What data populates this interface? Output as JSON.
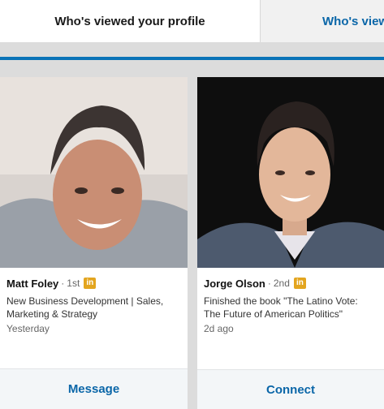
{
  "tabs": [
    {
      "label": "Who's viewed your profile",
      "active": true
    },
    {
      "label": "Who's viewed your updates",
      "active": false
    }
  ],
  "colors": {
    "accent": "#0a73b7",
    "link": "#0a66a8",
    "in_badge": "#e3a51f"
  },
  "cards": [
    {
      "name": "Matt Foley",
      "degree": "1st",
      "separator": "·",
      "badge": "in",
      "headline_line1": "New Business Development | Sales,",
      "headline_line2": "Marketing & Strategy",
      "time": "Yesterday",
      "action": "Message"
    },
    {
      "name": "Jorge Olson",
      "degree": "2nd",
      "separator": "·",
      "badge": "in",
      "headline_line1": "Finished the book \"The Latino Vote:",
      "headline_line2": "The Future of American Politics\"",
      "time": "2d ago",
      "action": "Connect"
    }
  ]
}
